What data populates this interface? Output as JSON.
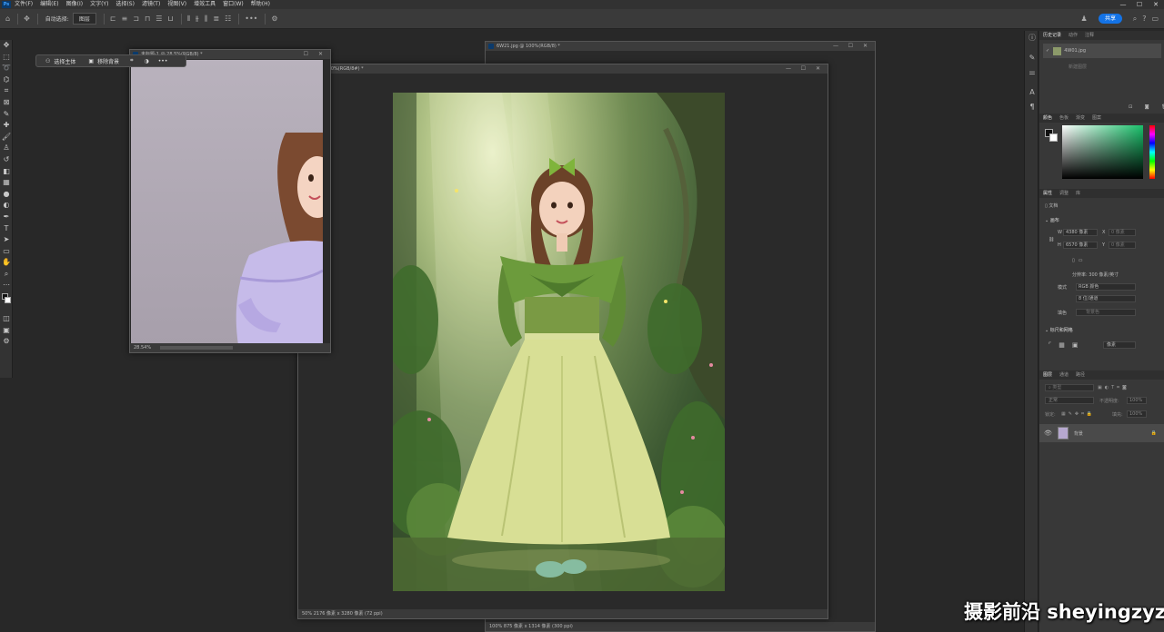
{
  "menu": {
    "items": [
      "文件(F)",
      "编辑(E)",
      "图像(I)",
      "文字(Y)",
      "选择(S)",
      "滤镜(T)",
      "视图(V)",
      "增效工具",
      "窗口(W)",
      "帮助(H)"
    ]
  },
  "window_controls": {
    "minimize": "—",
    "maximize": "☐",
    "close": "✕"
  },
  "options_bar": {
    "auto_select_label": "自动选择:",
    "auto_select_value": "图层",
    "share_label": "共享"
  },
  "context_bar": {
    "select_subject": "选择主体",
    "remove_background": "移除背景"
  },
  "documents": {
    "back": {
      "title": "6W21.jpg @ 100%(RGB/8) *",
      "status": "100%   875 像素 x 1314 像素 (300 ppi)"
    },
    "front": {
      "title": "3.jpg @ 50%(RGB/8#) *",
      "status": "50%   2176 像素 x 3280 像素 (72 ppi)"
    },
    "small": {
      "title": "未标题-1 @ 28.5%(RGB/8) *",
      "zoom": "28.54%"
    }
  },
  "history_panel": {
    "tabs": [
      "历史记录",
      "动作",
      "注释"
    ],
    "snapshot": "4W01.jpg",
    "step": "新建图层"
  },
  "color_panel": {
    "tabs": [
      "颜色",
      "色板",
      "渐变",
      "图案"
    ]
  },
  "properties_panel": {
    "tabs": [
      "属性",
      "调整",
      "库"
    ],
    "doc_label": "文档",
    "canvas_title": "画布",
    "w_label": "W",
    "w_value": "4380 像素",
    "x_label": "X",
    "x_value": "0 像素",
    "h_label": "H",
    "h_value": "6570 像素",
    "y_label": "Y",
    "y_value": "0 像素",
    "resolution": "分辨率: 300 像素/英寸",
    "mode_label": "模式",
    "mode_value": "RGB 颜色",
    "depth_value": "8 位/通道",
    "fill_label": "填色",
    "fill_value": "背景色",
    "rulers_title": "标尺和网格",
    "units_value": "像素"
  },
  "layers_panel": {
    "tabs": [
      "图层",
      "通道",
      "路径"
    ],
    "search_placeholder": "类型",
    "blend_mode": "正常",
    "opacity_label": "不透明度:",
    "opacity_value": "100%",
    "lock_label": "锁定:",
    "fill_label": "填充:",
    "fill_value": "100%",
    "layer_name": "背景"
  },
  "watermark": {
    "text": "摄影前沿 sheyingzyz.com"
  },
  "colors": {
    "accent": "#1473e6",
    "canvas_bg": "#282828"
  }
}
